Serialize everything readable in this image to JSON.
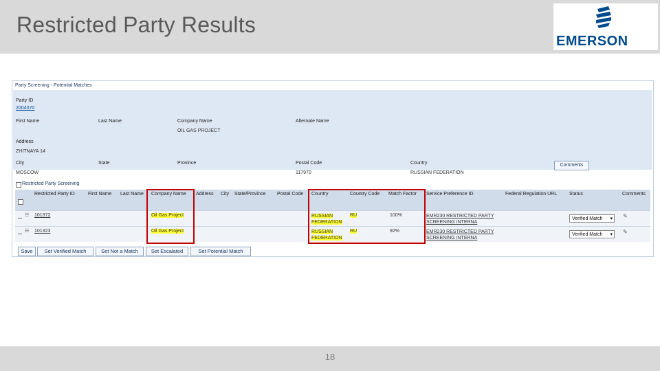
{
  "slide": {
    "title": "Restricted Party Results",
    "page_number": "18",
    "logo_text": "EMERSON"
  },
  "panel": {
    "section_title": "Party Screening - Potential Matches",
    "party_id_label": "Party ID",
    "party_id_value": "2004070",
    "first_name_label": "First Name",
    "last_name_label": "Last Name",
    "company_name_label": "Company Name",
    "company_name_value": "OIL GAS PROJECT",
    "alternate_name_label": "Alternate Name",
    "address_label": "Address",
    "address_value": "ZHITNAYA 14",
    "city_label": "City",
    "city_value": "MOSCOW",
    "state_label": "State",
    "province_label": "Province",
    "postal_code_label": "Postal Code",
    "postal_code_value": "117970",
    "country_label": "Country",
    "country_value": "RUSSIAN FEDERATION",
    "comments_button": "Comments"
  },
  "restricted": {
    "title": "Restricted Party Screening",
    "columns": [
      "Restricted Party ID",
      "First Name",
      "Last Name",
      "Company Name",
      "Address",
      "City",
      "State/Province",
      "Postal Code",
      "Country",
      "Country Code",
      "Match Factor",
      "Service Preference ID",
      "Federal Regulation URL",
      "Status",
      "Comments"
    ],
    "rows": [
      {
        "id": "101372",
        "company": "Oil Gas Project",
        "country_line1": "RUSSIAN",
        "country_line2": "FEDERATION",
        "country_code": "RU",
        "match_factor": "100%",
        "service_line1": "EMR230 RESTRICTED PARTY",
        "service_line2": "SCREENING INTERNA",
        "status": "Verified Match"
      },
      {
        "id": "101323",
        "company": "Oil Gas Project",
        "country_line1": "RUSSIAN",
        "country_line2": "FEDERATION",
        "country_code": "RU",
        "match_factor": "92%",
        "service_line1": "EMR230 RESTRICTED PARTY",
        "service_line2": "SCREENING INTERNA",
        "status": "Verified Match"
      }
    ]
  },
  "buttons": {
    "save": "Save",
    "set_verified": "Set Verified Match",
    "set_not_match": "Set Not a Match",
    "set_escalated": "Set Escalated",
    "set_potential": "Set Potential Match"
  },
  "colors": {
    "highlight": "#ffff33",
    "annotation": "#c00000",
    "brand": "#004b8d"
  }
}
